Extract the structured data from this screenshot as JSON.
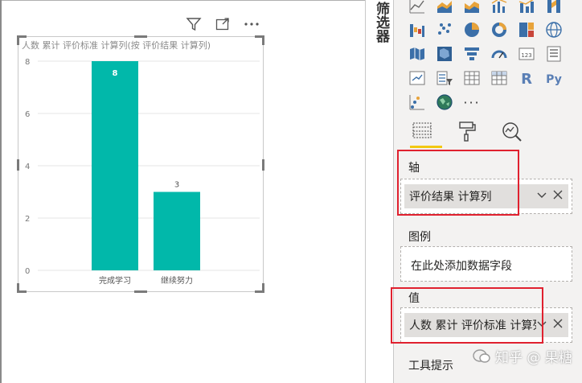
{
  "filters_pane": {
    "label": "筛选器"
  },
  "chart": {
    "title": "人数 累计 评价标准 计算列(按 评价结果 计算列)"
  },
  "chart_data": {
    "type": "bar",
    "categories": [
      "完成学习",
      "继续努力"
    ],
    "values": [
      8,
      3
    ],
    "data_labels": [
      "8",
      "3"
    ],
    "y_ticks": [
      "0",
      "2",
      "4",
      "6",
      "8"
    ],
    "ylim": [
      0,
      8
    ],
    "title": "人数 累计 评价标准 计算列(按 评价结果 计算列)",
    "xlabel": "",
    "ylabel": "",
    "grid": true,
    "bar_color": "#01b8aa"
  },
  "visual_toolbar": {
    "icons": [
      "filter-icon",
      "focus-mode-icon",
      "more-options-icon"
    ]
  },
  "viz_pane": {
    "tabs": [
      "fields-tab",
      "format-tab",
      "analytics-tab"
    ],
    "more_label": "···",
    "r_label": "R",
    "py_label": "Py",
    "table_label": "123"
  },
  "wells": {
    "axis": {
      "label": "轴",
      "value": "评价结果 计算列"
    },
    "legend": {
      "label": "图例",
      "placeholder": "在此处添加数据字段"
    },
    "values": {
      "label": "值",
      "value": "人数 累计 评价标准 计算列"
    },
    "tooltips": {
      "label": "工具提示"
    }
  },
  "watermark": {
    "text": "知乎 @ 果糖"
  },
  "colors": {
    "accent": "#f2c811",
    "highlight": "#e0212f",
    "bar": "#01b8aa"
  }
}
